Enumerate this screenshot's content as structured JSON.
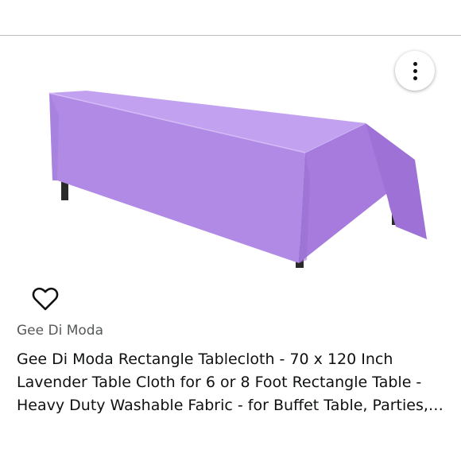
{
  "product": {
    "brand": "Gee Di Moda",
    "title": "Gee Di Moda Rectangle Tablecloth - 70 x 120 Inch Lavender Table Cloth for 6 or 8 Foot Rectangle Table - Heavy Duty Washable Fabric - for Buffet Table, Parties, Holiday Dinner, Wedding & More",
    "image_icon": "lavender-tablecloth-photo",
    "image_color": "#b48be8"
  },
  "actions": {
    "more_icon": "kebab-menu-icon",
    "wishlist_icon": "heart-outline-icon"
  }
}
